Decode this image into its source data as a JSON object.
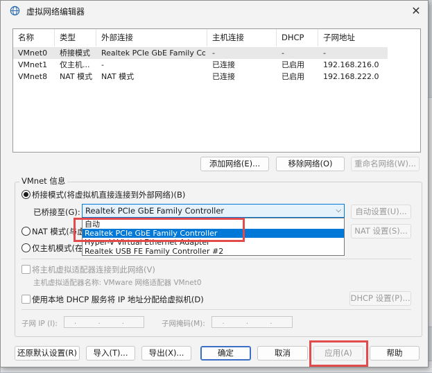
{
  "window": {
    "title": "虚拟网络编辑器",
    "close_glyph": "✕"
  },
  "table": {
    "headers": [
      "名称",
      "类型",
      "外部连接",
      "主机连接",
      "DHCP",
      "子网地址"
    ],
    "rows": [
      [
        "VMnet0",
        "桥接模式",
        "Realtek PCIe GbE Family Co...",
        "-",
        "-",
        "-"
      ],
      [
        "VMnet1",
        "仅主机...",
        "-",
        "已连接",
        "已启用",
        "192.168.216.0"
      ],
      [
        "VMnet8",
        "NAT 模式",
        "NAT 模式",
        "已连接",
        "已启用",
        "192.168.222.0"
      ]
    ]
  },
  "net_buttons": {
    "add": "添加网络(E)...",
    "remove": "移除网络(O)",
    "rename": "重命名网络(W)..."
  },
  "vmnet_info": {
    "title": "VMnet 信息",
    "bridge_label": "桥接模式(将虚拟机直接连接到外部网络)(B)",
    "bridged_to_label": "已桥接至(G):",
    "bridged_to_value": "Realtek PCIe GbE Family Controller",
    "auto_settings": "自动设置(U)...",
    "nat_label": "NAT 模式(与虚",
    "nat_settings": "NAT 设置(S)...",
    "hostonly_label": "仅主机模式(在",
    "connect_host_adapter": "将主机虚拟适配器连接到此网络(V)",
    "host_adapter_name": "主机虚拟适配器名称: VMware 网络适配器 VMnet0",
    "use_dhcp": "使用本地 DHCP 服务将 IP 地址分配给虚拟机(D)",
    "dhcp_settings": "DHCP 设置(P)...",
    "subnet_ip_label": "子网 IP (I):",
    "subnet_mask_label": "子网掩码(M):",
    "ip_placeholder": ". . ."
  },
  "dropdown": {
    "options": [
      "自动",
      "Realtek PCIe GbE Family Controller",
      "Hyper-V Virtual Ethernet Adapter",
      "Realtek USB FE Family Controller #2"
    ],
    "selected_index": 1
  },
  "bottom_buttons": {
    "restore": "还原默认设置(R)",
    "import": "导入(T)...",
    "export": "导出(X)...",
    "ok": "确定",
    "cancel": "取消",
    "apply": "应用(A)",
    "help": "帮助"
  },
  "background_fragments": {
    "left_p": "P)",
    "left_settings": "设",
    "left_fix": "助"
  },
  "colors": {
    "accent": "#0078d7",
    "highlight_box": "#e24b4b"
  }
}
